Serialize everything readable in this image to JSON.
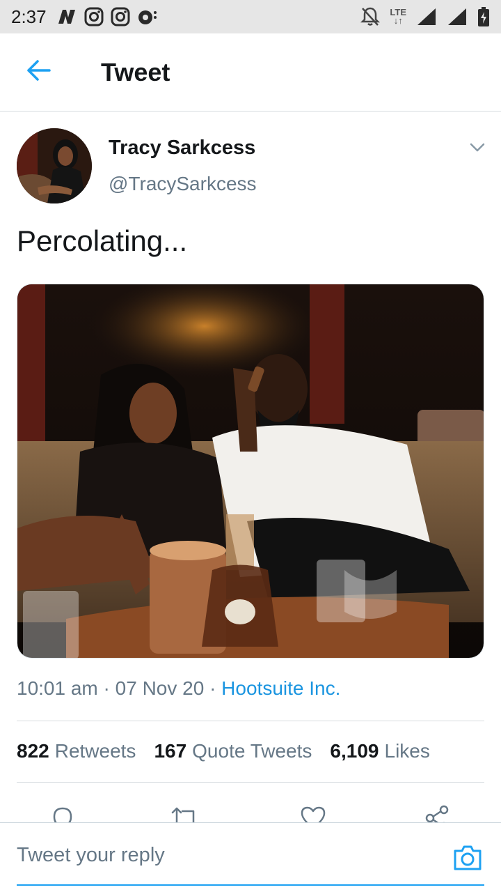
{
  "status_bar": {
    "time": "2:37",
    "network_label": "LTE",
    "icons": [
      "nytimes-icon",
      "instagram-icon",
      "instagram-icon",
      "podcast-icon",
      "notifications-off-icon",
      "signal-icon",
      "signal-icon",
      "battery-charging-icon"
    ]
  },
  "header": {
    "title": "Tweet",
    "back_icon": "arrow-left-icon"
  },
  "tweet": {
    "author_name": "Tracy Sarkcess",
    "author_handle": "@TracySarkcess",
    "text": "Percolating...",
    "time": "10:01 am",
    "date": "07 Nov 20",
    "separator": "·",
    "source": "Hootsuite Inc.",
    "stats": {
      "retweets_count": "822",
      "retweets_label": "Retweets",
      "quotes_count": "167",
      "quotes_label": "Quote Tweets",
      "likes_count": "6,109",
      "likes_label": "Likes"
    },
    "actions": [
      "reply-icon",
      "retweet-icon",
      "like-icon",
      "share-icon"
    ]
  },
  "reply": {
    "placeholder": "Tweet your reply"
  },
  "colors": {
    "accent": "#1da1f2",
    "link": "#1b95e0",
    "secondary_text": "#657786",
    "primary_text": "#14171a",
    "status_bar_bg": "#e6e6e6"
  }
}
